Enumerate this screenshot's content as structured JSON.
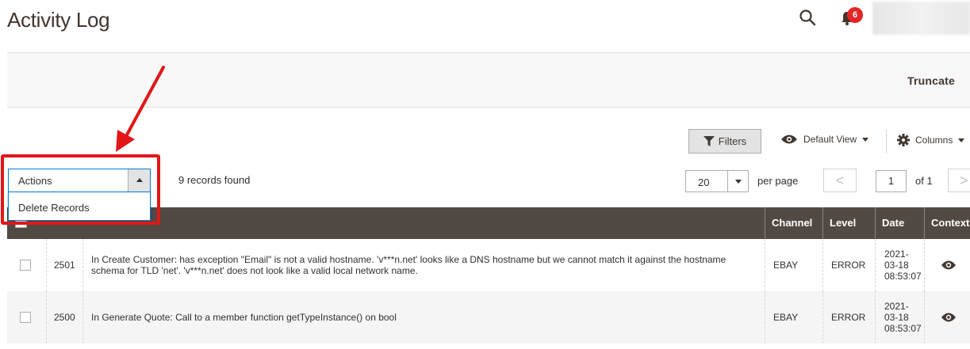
{
  "header": {
    "title": "Activity Log",
    "notifications_count": "6",
    "search_icon": "search-icon",
    "bell_icon": "bell-icon"
  },
  "action_bar": {
    "truncate_label": "Truncate"
  },
  "toolbar": {
    "filters_label": "Filters",
    "view_label": "Default View",
    "columns_label": "Columns",
    "actions_label": "Actions",
    "actions_menu": [
      "Delete Records"
    ],
    "records_found": "9 records found",
    "per_page_value": "20",
    "per_page_label": "per page",
    "prev_label": "<",
    "next_label": ">",
    "current_page": "1",
    "of_label": "of 1"
  },
  "grid": {
    "columns": [
      "Channel",
      "Level",
      "Date",
      "Context"
    ],
    "rows": [
      {
        "id": "2501",
        "message": "In Create Customer: has exception \"Email\" is not a valid hostname. 'v***n.net' looks like a DNS hostname but we cannot match it against the hostname schema for TLD 'net'. 'v***n.net' does not look like a valid local network name.",
        "channel": "EBAY",
        "level": "ERROR",
        "date": "2021-\n03-18\n08:53:07"
      },
      {
        "id": "2500",
        "message": "In Generate Quote: Call to a member function getTypeInstance() on bool",
        "channel": "EBAY",
        "level": "ERROR",
        "date": "2021-\n03-18\n08:53:07"
      }
    ]
  },
  "colors": {
    "header_bg": "#514943",
    "annotation_red": "#e31616",
    "badge_red": "#e22626",
    "focus_blue": "#007bdb"
  }
}
